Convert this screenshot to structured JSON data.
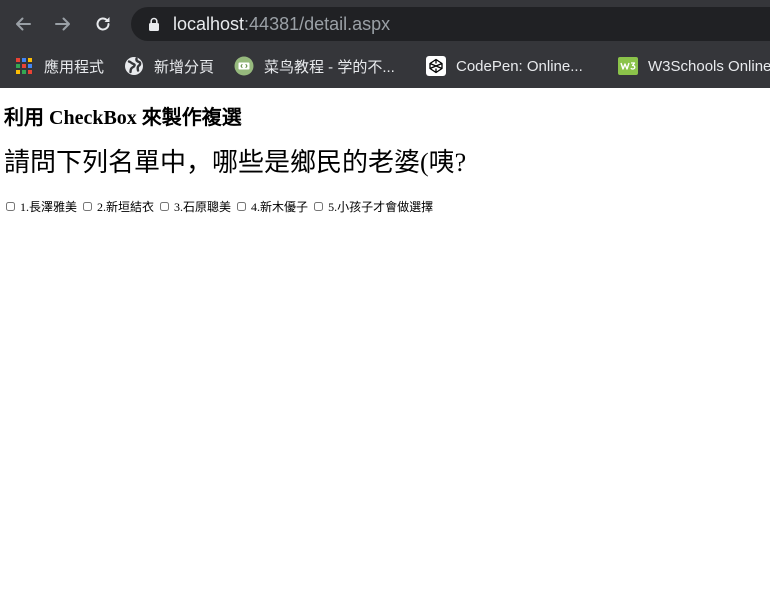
{
  "browser": {
    "url_host": "localhost",
    "url_rest": ":44381/detail.aspx",
    "bookmarks": [
      {
        "label": "應用程式",
        "icon": "apps-grid-icon"
      },
      {
        "label": "新增分頁",
        "icon": "globe-icon"
      },
      {
        "label": "菜鸟教程 - 学的不...",
        "icon": "runoob-icon"
      },
      {
        "label": "CodePen: Online...",
        "icon": "codepen-icon"
      },
      {
        "label": "W3Schools Online...",
        "icon": "w3schools-icon"
      }
    ],
    "colors": {
      "toolbar": "#35363a",
      "omnibox": "#202124",
      "text": "#e8eaed",
      "muted": "#9aa0a6"
    }
  },
  "page": {
    "subtitle": "利用 CheckBox 來製作複選",
    "question": "請問下列名單中，哪些是鄉民的老婆(咦?",
    "options": [
      {
        "label": "1.長澤雅美",
        "checked": false
      },
      {
        "label": "2.新垣結衣",
        "checked": false
      },
      {
        "label": "3.石原聰美",
        "checked": false
      },
      {
        "label": "4.新木優子",
        "checked": false
      },
      {
        "label": "5.小孩子才會做選擇",
        "checked": false
      }
    ]
  }
}
